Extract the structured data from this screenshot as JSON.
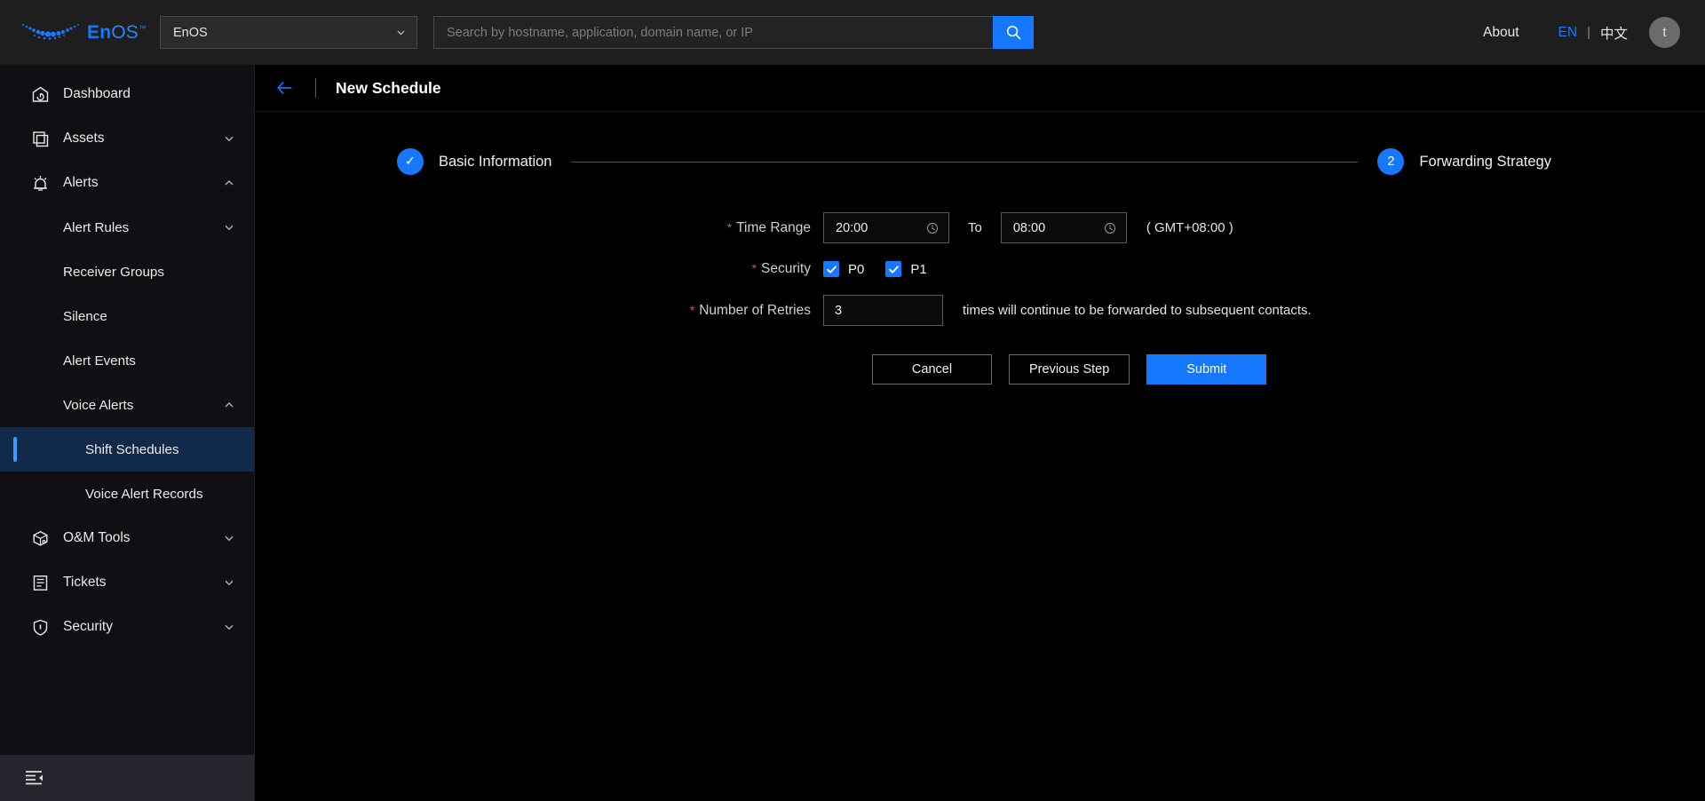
{
  "header": {
    "logo_text_bold": "En",
    "logo_text_light": "OS",
    "logo_trademark": "™",
    "app_selector_value": "EnOS",
    "search_placeholder": "Search by hostname, application, domain name, or IP",
    "search_value": "",
    "about_label": "About",
    "lang_en": "EN",
    "lang_separator": "|",
    "lang_cn": "中文",
    "avatar_initial": "t"
  },
  "sidebar": {
    "items": [
      {
        "label": "Dashboard",
        "icon": "dashboard-icon",
        "level": 0,
        "arrow": "none",
        "active": false
      },
      {
        "label": "Assets",
        "icon": "assets-icon",
        "level": 0,
        "arrow": "down",
        "active": false
      },
      {
        "label": "Alerts",
        "icon": "alerts-icon",
        "level": 0,
        "arrow": "up",
        "active": false
      },
      {
        "label": "Alert Rules",
        "icon": "none",
        "level": 1,
        "arrow": "down",
        "active": false
      },
      {
        "label": "Receiver Groups",
        "icon": "none",
        "level": 1,
        "arrow": "none",
        "active": false
      },
      {
        "label": "Silence",
        "icon": "none",
        "level": 1,
        "arrow": "none",
        "active": false
      },
      {
        "label": "Alert Events",
        "icon": "none",
        "level": 1,
        "arrow": "none",
        "active": false
      },
      {
        "label": "Voice Alerts",
        "icon": "none",
        "level": 1,
        "arrow": "up",
        "active": false
      },
      {
        "label": "Shift Schedules",
        "icon": "none",
        "level": 2,
        "arrow": "none",
        "active": true
      },
      {
        "label": "Voice Alert Records",
        "icon": "none",
        "level": 2,
        "arrow": "none",
        "active": false
      },
      {
        "label": "O&M Tools",
        "icon": "tools-icon",
        "level": 0,
        "arrow": "down",
        "active": false
      },
      {
        "label": "Tickets",
        "icon": "tickets-icon",
        "level": 0,
        "arrow": "down",
        "active": false
      },
      {
        "label": "Security",
        "icon": "shield-icon",
        "level": 0,
        "arrow": "down",
        "active": false
      }
    ],
    "collapse_icon": "menu-collapse-icon"
  },
  "page": {
    "back_icon": "back-arrow-icon",
    "title": "New Schedule"
  },
  "stepper": {
    "steps": [
      {
        "bullet": "✓",
        "label": "Basic Information",
        "state": "done"
      },
      {
        "bullet": "2",
        "label": "Forwarding Strategy",
        "state": "current"
      }
    ]
  },
  "form": {
    "time_range": {
      "required_mark": "*",
      "label": "Time Range",
      "start_value": "20:00",
      "to_word": "To",
      "end_value": "08:00",
      "timezone": "( GMT+08:00 )",
      "icon": "clock-icon"
    },
    "security": {
      "required_mark": "*",
      "label": "Security",
      "options": [
        {
          "label": "P0",
          "checked": true
        },
        {
          "label": "P1",
          "checked": true
        }
      ]
    },
    "retries": {
      "required_mark": "*",
      "label": "Number of Retries",
      "value": "3",
      "hint": "times will continue to be forwarded to subsequent contacts."
    },
    "buttons": {
      "cancel": "Cancel",
      "previous": "Previous Step",
      "submit": "Submit"
    }
  },
  "colors": {
    "accent": "#1677ff",
    "header_bg": "#1e1e1e",
    "sidebar_bg": "#101014",
    "main_bg": "#000000",
    "active_nav_bg": "#112a4a",
    "active_nav_bar": "#3d9bff",
    "required_red": "#d9534f"
  }
}
